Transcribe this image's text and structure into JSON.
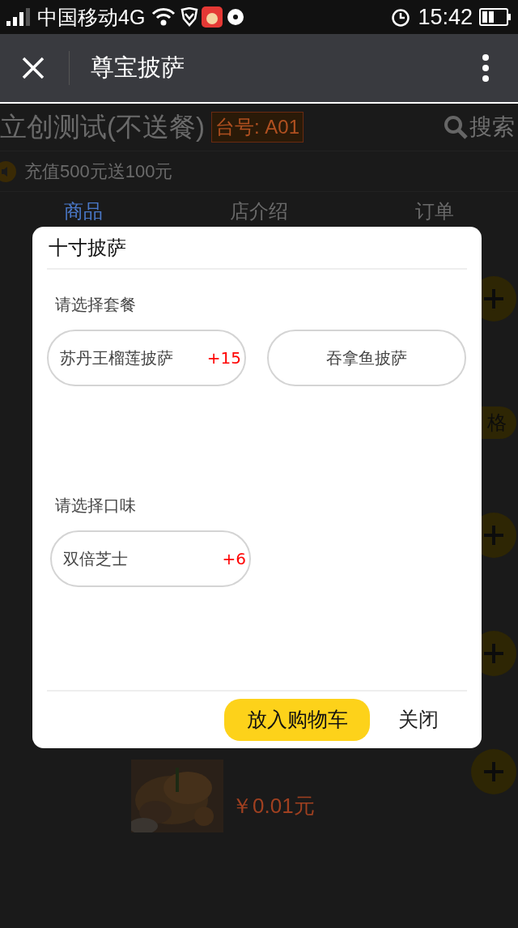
{
  "status_bar": {
    "carrier": "中国移动4G",
    "time": "15:42"
  },
  "nav": {
    "title": "尊宝披萨"
  },
  "shop": {
    "name": "立创测试(不送餐)",
    "table_tag": "台号: A01",
    "search": "搜索"
  },
  "notice": "充值500元送100元",
  "tabs": [
    {
      "label": "商品",
      "selected": true
    },
    {
      "label": "店介绍",
      "selected": false
    },
    {
      "label": "订单",
      "selected": false
    }
  ],
  "menu_rows": [
    {
      "kind": "add"
    },
    {
      "kind": "spec",
      "label": "格"
    },
    {
      "kind": "add"
    },
    {
      "kind": "add"
    },
    {
      "kind": "add",
      "price": "￥0.01元"
    }
  ],
  "dialog": {
    "title": "十寸披萨",
    "groups": [
      {
        "label": "请选择套餐",
        "options": [
          {
            "name": "苏丹王榴莲披萨",
            "extra": "+15",
            "selected": false
          },
          {
            "name": "吞拿鱼披萨",
            "selected": false
          }
        ]
      },
      {
        "label": "请选择口味",
        "options": [
          {
            "name": "双倍芝士",
            "extra": "+6",
            "selected": false
          }
        ]
      }
    ],
    "buttons": [
      {
        "label": "放入购物车",
        "kind": "primary"
      },
      {
        "label": "关闭",
        "kind": "plain"
      }
    ]
  }
}
